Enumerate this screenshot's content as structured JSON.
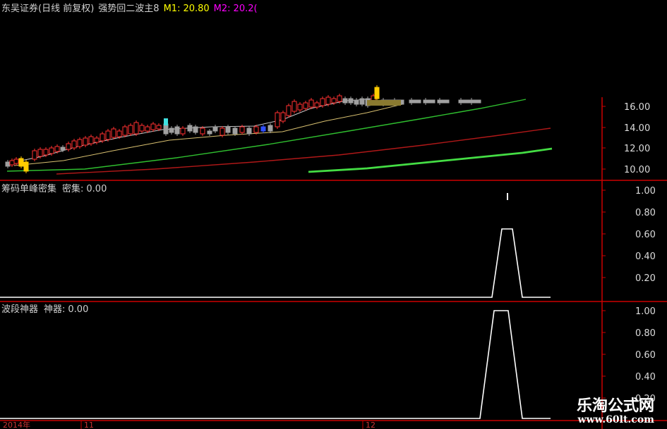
{
  "header": {
    "stock_title": "东吴证券(日线 前复权)",
    "indicator_name": "强势回二波主",
    "indicator_value": "8",
    "m1_label": "M1:",
    "m1_value": "20.80",
    "m2_label": "M2:",
    "m2_value": "20.2("
  },
  "panels": [
    {
      "name": "筹码单峰密集",
      "value_label": "密集:",
      "value": "0.00",
      "axis_ticks": [
        "1.00",
        "0.80",
        "0.60",
        "0.40",
        "0.20"
      ]
    },
    {
      "name": "波段神器",
      "value_label": "神器:",
      "value": "0.00",
      "axis_ticks": [
        "1.00",
        "0.80",
        "0.60",
        "0.40",
        "0.20"
      ]
    }
  ],
  "price_axis": {
    "ticks": [
      "16.00",
      "14.00",
      "12.00",
      "10.00"
    ]
  },
  "time_axis": {
    "labels": [
      "2014年",
      "11",
      "12"
    ]
  },
  "watermark": {
    "title": "乐淘公式网",
    "url": "www.60lt.com"
  },
  "colors": {
    "background": "#000000",
    "axis": "#cc0000",
    "up_candle": "#ff3030",
    "down_candle": "#a0a0a0",
    "ma_green": "#2fbf2f",
    "ma_red": "#b01818",
    "ma_bright_green": "#44dd44",
    "ma_yellow": "#d8c070",
    "signal_line": "#ffffff",
    "m1_text": "#ffff00",
    "m2_text": "#ff00ff"
  }
}
